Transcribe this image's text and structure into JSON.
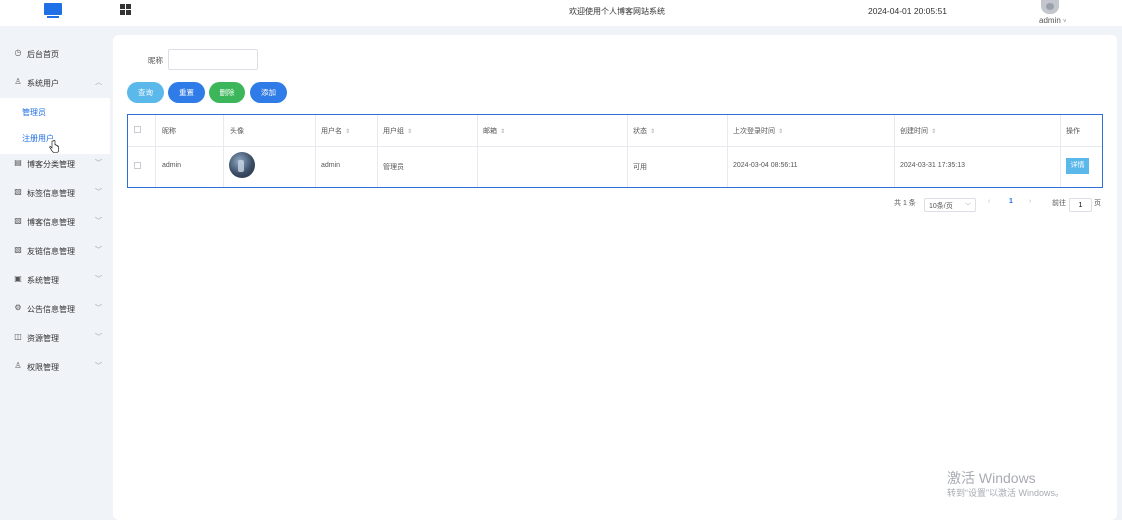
{
  "header": {
    "title": "欢迎使用个人博客网站系统",
    "datetime": "2024-04-01 20:05:51",
    "username": "admin",
    "user_dropdown": "˅"
  },
  "sidebar": {
    "items": [
      {
        "label": "后台首页",
        "icon": "clock-icon",
        "glyph": "◷",
        "chevron": ""
      },
      {
        "label": "系统用户",
        "icon": "user-icon",
        "glyph": "♙",
        "chevron": "︿"
      },
      {
        "label": "博客分类管理",
        "icon": "list-icon",
        "glyph": "▤",
        "chevron": "﹀"
      },
      {
        "label": "标签信息管理",
        "icon": "tag-icon",
        "glyph": "▧",
        "chevron": "﹀"
      },
      {
        "label": "博客信息管理",
        "icon": "doc-icon",
        "glyph": "▧",
        "chevron": "﹀"
      },
      {
        "label": "友链信息管理",
        "icon": "link-icon",
        "glyph": "▧",
        "chevron": "﹀"
      },
      {
        "label": "系统管理",
        "icon": "system-icon",
        "glyph": "▣",
        "chevron": "﹀"
      },
      {
        "label": "公告信息管理",
        "icon": "settings-icon",
        "glyph": "⚙",
        "chevron": "﹀"
      },
      {
        "label": "资源管理",
        "icon": "resource-icon",
        "glyph": "◫",
        "chevron": "﹀"
      },
      {
        "label": "权限管理",
        "icon": "person-icon",
        "glyph": "♙",
        "chevron": "﹀"
      }
    ],
    "sub_items": [
      "管理员",
      "注册用户"
    ]
  },
  "search": {
    "label": "昵称",
    "value": "",
    "placeholder": ""
  },
  "actions": {
    "query": "查询",
    "reset": "重置",
    "delete": "删除",
    "add": "添加"
  },
  "table": {
    "headers": [
      "昵称",
      "头像",
      "用户名",
      "用户组",
      "邮箱",
      "状态",
      "上次登录时间",
      "创建时间",
      "操作"
    ],
    "sort_glyph": "⇕",
    "rows": [
      {
        "nickname": "admin",
        "username": "admin",
        "group": "管理员",
        "email": "",
        "status": "可用",
        "last_login": "2024-03-04 08:56:11",
        "created": "2024-03-31 17:35:13",
        "action": "详情"
      }
    ]
  },
  "pagination": {
    "total": "共 1 条",
    "page_size": "10条/页",
    "prev": "‹",
    "current": "1",
    "next": "›",
    "goto_prefix": "前往",
    "goto_value": "1",
    "goto_suffix": "页"
  },
  "watermark": {
    "line1": "激活 Windows",
    "line2": "转到“设置”以激活 Windows。"
  },
  "colors": {
    "primary": "#1f6fe6",
    "query": "#5ab8ea",
    "reset": "#2f7be8",
    "delete": "#3cb65a",
    "add": "#2f7be8"
  }
}
